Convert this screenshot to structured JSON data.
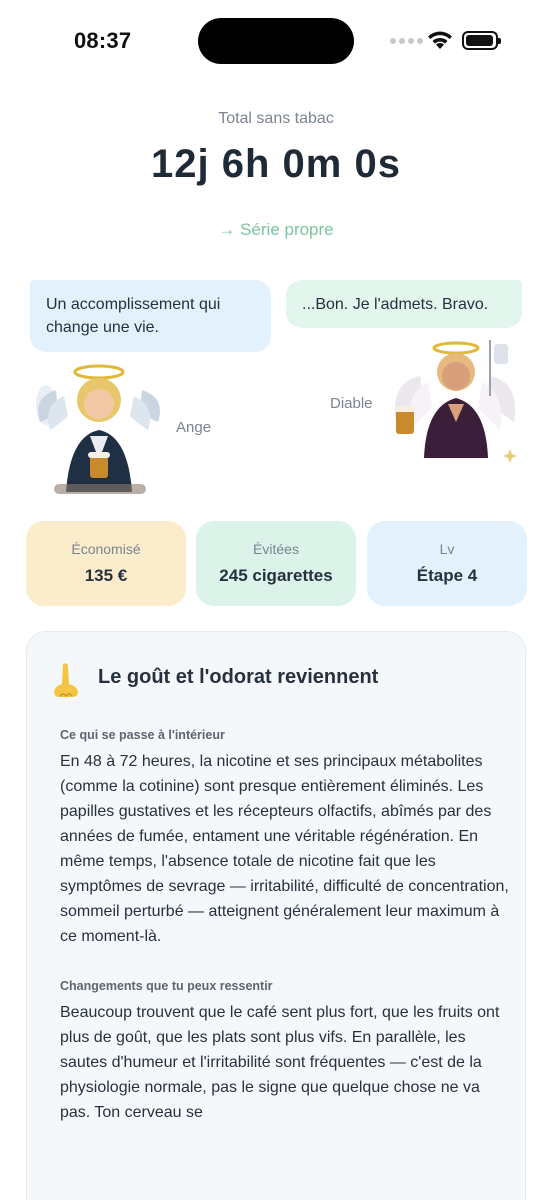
{
  "status_bar": {
    "time": "08:37"
  },
  "header": {
    "total_label": "Total sans tabac",
    "total_value": "12j 6h 0m 0s",
    "streak_label": "→ Série propre",
    "streak_color": "#7cc5a0"
  },
  "characters": {
    "angel": {
      "message": "Un accomplissement qui change une vie.",
      "name": "Ange"
    },
    "devil": {
      "message": "...Bon. Je l'admets. Bravo.",
      "name": "Diable"
    }
  },
  "stats": [
    {
      "label": "Économisé",
      "value": "135 €",
      "color": "#fbeccb"
    },
    {
      "label": "Évitées",
      "value": "245 cigarettes",
      "color": "#dcf3ea"
    },
    {
      "label": "Lv",
      "value": "Étape 4",
      "color": "#e2f1fb"
    }
  ],
  "milestone": {
    "icon": "nose-icon",
    "title": "Le goût et l'odorat reviennent",
    "sections": [
      {
        "label": "Ce qui se passe à l'intérieur",
        "text": "En 48 à 72 heures, la nicotine et ses principaux métabolites (comme la cotinine) sont presque entièrement éliminés. Les papilles gustatives et les récepteurs olfactifs, abîmés par des années de fumée, entament une véritable régénération. En même temps, l'absence totale de nicotine fait que les symptômes de sevrage — irritabilité, difficulté de concentration, sommeil perturbé — atteignent généralement leur maximum à ce moment-là."
      },
      {
        "label": "Changements que tu peux ressentir",
        "text": "Beaucoup trouvent que le café sent plus fort, que les fruits ont plus de goût, que les plats sont plus vifs. En parallèle, les sautes d'humeur et l'irritabilité sont fréquentes — c'est de la physiologie normale, pas le signe que quelque chose ne va pas. Ton cerveau se"
      }
    ]
  }
}
